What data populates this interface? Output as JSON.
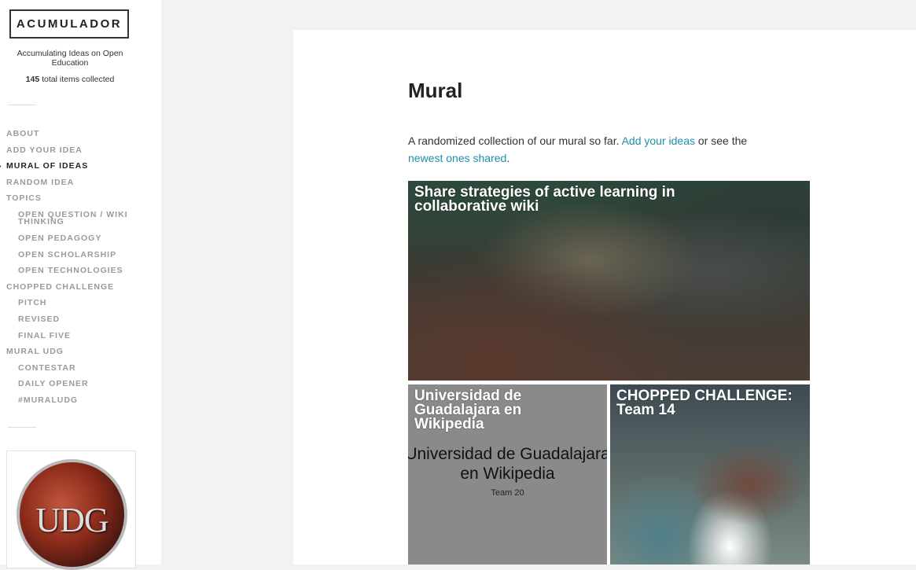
{
  "site": {
    "title": "ACUMULADOR",
    "description": "Accumulating Ideas on Open Education",
    "count_number": "145",
    "count_suffix": " total items collected"
  },
  "nav": {
    "about": "ABOUT",
    "add_idea": "ADD YOUR IDEA",
    "mural": "MURAL OF IDEAS",
    "random": "RANDOM IDEA",
    "topics": "TOPICS",
    "open_question": "OPEN QUESTION / WIKI THINKING",
    "open_pedagogy": "OPEN PEDAGOGY",
    "open_scholarship": "OPEN SCHOLARSHIP",
    "open_technologies": "OPEN TECHNOLOGIES",
    "chopped": "CHOPPED CHALLENGE",
    "pitch": "PITCH",
    "revised": "REVISED",
    "final_five": "FINAL FIVE",
    "mural_udg": "MURAL UDG",
    "contestar": "CONTESTAR",
    "daily_opener": "DAILY OPENER",
    "muraludg": "#MURALUDG",
    "active_marker": "›"
  },
  "widget": {
    "logo_text": "UDG"
  },
  "page": {
    "title": "Mural",
    "intro_before": "A randomized collection of our mural so far. ",
    "intro_link1": "Add your ideas",
    "intro_middle": " or see the ",
    "intro_link2": "newest ones shared",
    "intro_after": "."
  },
  "tiles": [
    {
      "title": "Share strategies of active learning in collaborative wiki"
    },
    {
      "title": "Universidad de Guadalajara en Wikipedia",
      "inner_title": "Universidad de Guadalajara en Wikipedia",
      "inner_team": "Team 20"
    },
    {
      "title": "CHOPPED CHALLENGE: Team 14"
    }
  ],
  "colors": {
    "link": "#1e8fae",
    "nav_inactive": "#9a9a9a",
    "nav_active": "#222222",
    "background": "#f2f2f2"
  }
}
